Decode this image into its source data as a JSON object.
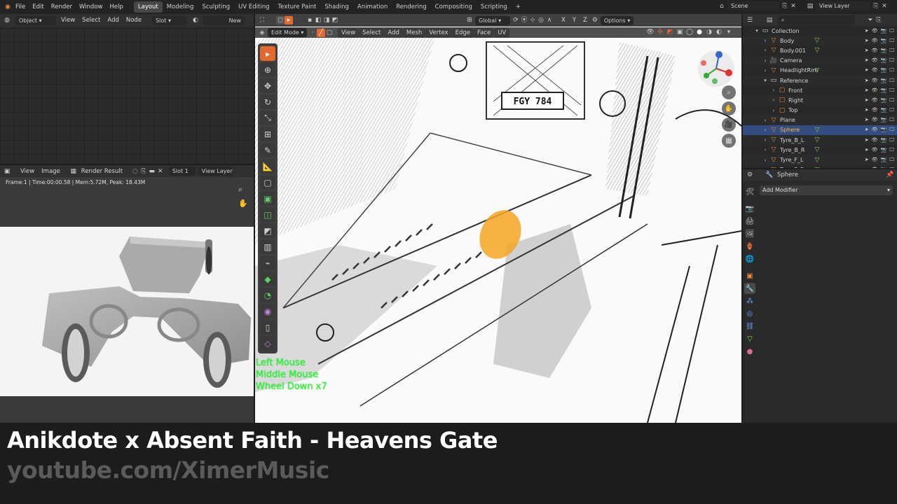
{
  "topbar": {
    "menu": [
      "File",
      "Edit",
      "Render",
      "Window",
      "Help"
    ],
    "workspaces": [
      "Layout",
      "Modeling",
      "Sculpting",
      "UV Editing",
      "Texture Paint",
      "Shading",
      "Animation",
      "Rendering",
      "Compositing",
      "Scripting"
    ],
    "active_workspace": "Layout",
    "add_tab": "+",
    "scene": "Scene",
    "view_layer": "View Layer"
  },
  "shader_editor": {
    "object_mode": "Object",
    "menu": [
      "View",
      "Select",
      "Add",
      "Node"
    ],
    "slot": "Slot",
    "new_label": "New"
  },
  "image_editor": {
    "menu": [
      "View",
      "Image"
    ],
    "image_name": "Render Result",
    "slot": "Slot 1",
    "view_layer": "View Layer",
    "status": "Frame:1 | Time:00:00.58 | Mem:5.72M, Peak: 18.43M"
  },
  "viewport": {
    "mode": "Edit Mode",
    "menu": [
      "View",
      "Select",
      "Add",
      "Mesh",
      "Vertex",
      "Edge",
      "Face",
      "UV"
    ],
    "orientation": "Global",
    "axes": [
      "X",
      "Y",
      "Z"
    ],
    "options": "Options",
    "hud_lines": [
      "Left Mouse",
      "Middle Mouse",
      "Wheel Down x7"
    ],
    "plate_text": "FGY 784"
  },
  "outliner": {
    "items": [
      {
        "name": "Collection",
        "depth": 0,
        "icon": "collection-icon",
        "selected": false
      },
      {
        "name": "Body",
        "depth": 1,
        "icon": "mesh-icon",
        "selected": false
      },
      {
        "name": "Body.001",
        "depth": 1,
        "icon": "mesh-icon",
        "selected": false
      },
      {
        "name": "Camera",
        "depth": 1,
        "icon": "camera-icon",
        "selected": false
      },
      {
        "name": "HeadlightRim",
        "depth": 1,
        "icon": "mesh-icon",
        "selected": false
      },
      {
        "name": "Reference",
        "depth": 1,
        "icon": "collection-icon",
        "selected": false
      },
      {
        "name": "Front",
        "depth": 2,
        "icon": "image-icon",
        "selected": false
      },
      {
        "name": "Right",
        "depth": 2,
        "icon": "image-icon",
        "selected": false
      },
      {
        "name": "Top",
        "depth": 2,
        "icon": "image-icon",
        "selected": false
      },
      {
        "name": "Plane",
        "depth": 1,
        "icon": "mesh-icon",
        "selected": false
      },
      {
        "name": "Sphere",
        "depth": 1,
        "icon": "mesh-icon",
        "selected": true
      },
      {
        "name": "Tyre_B_L",
        "depth": 1,
        "icon": "mesh-icon",
        "selected": false
      },
      {
        "name": "Tyre_B_R",
        "depth": 1,
        "icon": "mesh-icon",
        "selected": false
      },
      {
        "name": "Tyre_F_L",
        "depth": 1,
        "icon": "mesh-icon",
        "selected": false
      },
      {
        "name": "Tyre_F_R",
        "depth": 1,
        "icon": "mesh-icon",
        "selected": false
      }
    ]
  },
  "properties": {
    "object_name": "Sphere",
    "add_modifier": "Add Modifier"
  },
  "caption": {
    "title": "Anikdote x Absent Faith - Heavens Gate",
    "subtitle": "youtube.com/XimerMusic"
  },
  "colors": {
    "accent": "#e36a2c",
    "selection": "#334d80",
    "hud_green": "#2dff3a"
  }
}
